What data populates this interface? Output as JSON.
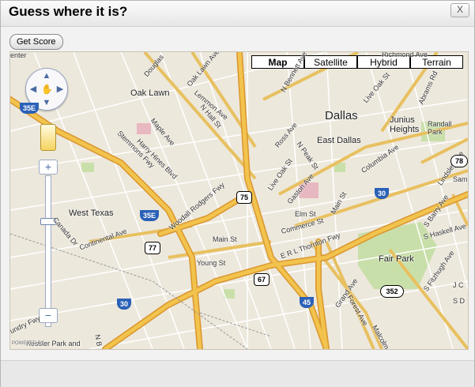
{
  "dialog": {
    "title": "Guess where it is?",
    "close_label": "X"
  },
  "toolbar": {
    "get_score_label": "Get Score"
  },
  "map": {
    "map_types": [
      {
        "label": "Map",
        "active": true
      },
      {
        "label": "Satellite",
        "active": false
      },
      {
        "label": "Hybrid",
        "active": false
      },
      {
        "label": "Terrain",
        "active": false
      }
    ],
    "controls": {
      "zoom_in": "+",
      "zoom_out": "−"
    },
    "labels": {
      "dallas": "Dallas",
      "junius_heights": "Junius Heights",
      "east_dallas": "East Dallas",
      "oak_lawn": "Oak Lawn",
      "west_texas": "West Texas",
      "fair_park": "Fair Park",
      "randall_park": "Randall Park",
      "kessler": "Kessler Park and",
      "center": "enter",
      "douglas": "Douglas",
      "oak_lawn_ave": "Oak Lawn Ave",
      "lemmon_ave": "Lemmon Ave",
      "n_hall_st": "N Hall St",
      "maple_ave": "Maple Ave",
      "harry_hines": "Harry Hines Blvd",
      "stemmons": "Stemmons Fwy",
      "woodall": "Woodall Rodgers Fwy",
      "ross_ave": "Ross Ave",
      "n_peak_st": "N Peak St",
      "live_oak_st": "Live Oak St",
      "live_oak_st_2": "Live Oak St",
      "gaston_ave": "Gaston Ave",
      "elm_st": "Elm St",
      "main_st": "Main St",
      "main_st_2": "Main St",
      "commerce_st": "Commerce St",
      "young_st": "Young St",
      "rl_thornton": "E R L Thornton Fwy",
      "continental": "Continental Ave",
      "canada_dr": "Canada Dr",
      "columbia_ave": "Columbia Ave",
      "lindsley_ave": "Lindsley Ave",
      "abrams_rd": "Abrams Rd",
      "richmond_ave": "Richmond Ave",
      "s_barry_ave": "S Barry Ave",
      "s_haskell": "S Haskell Ave",
      "s_fitzhugh": "S Fitzhugh Ave",
      "grand_ave": "Grand Ave",
      "forest_ave": "Forest Ave",
      "malcolm": "Malcolm",
      "laundry_fwy": "undry Fwy",
      "n_bennett": "N Bennett Ave",
      "sam": "Sam",
      "jc": "J C",
      "sdal": "S D",
      "n_b": "N B"
    },
    "shields": {
      "i35e_a": "35E",
      "i35e_b": "35E",
      "us75": "75",
      "us77": "77",
      "i30_a": "30",
      "i30_b": "30",
      "us67": "67",
      "i45": "45",
      "sh352": "352",
      "sh78": "78"
    },
    "copyright": "POWERED BY"
  },
  "colors": {
    "freeway": "#f2c34d",
    "freeway_edge": "#d9962f",
    "major_road": "#fbe79a",
    "park": "#c9dfaa",
    "interstate": "#2b61b8",
    "land": "#ede8dc"
  }
}
